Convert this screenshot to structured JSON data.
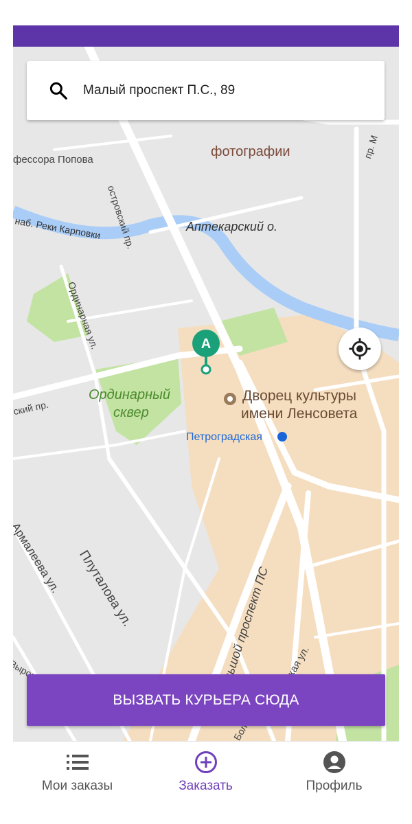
{
  "search": {
    "value": "Малый проспект П.С., 89",
    "icon": "search-icon"
  },
  "map": {
    "labels": {
      "photo": "фотографии",
      "popov": "фессора Попова",
      "ostrovsky": "островский пр.",
      "aptekarsky": "Аптекарский о.",
      "karpovka": "наб. Реки Карповки",
      "ordinarnaya": "Ординарная ул.",
      "skver1": "Ординарный",
      "skver2": "сквер",
      "palace1": "Дворец культуры",
      "palace2": "имени Ленсовета",
      "metro": "Петроградская",
      "skiy": "ский пр.",
      "plutalova": "Плуталова ул.",
      "armaleeva": "Армалеева ул.",
      "bolshoy": "Большой проспект ПС",
      "karskaya": "Карская ул.",
      "vyrova": "Вырова",
      "prm": "пр. М",
      "bol": "Бол"
    },
    "pin_label": "A",
    "colors": {
      "road": "#ffffff",
      "water": "#a9cdf7",
      "park": "#c3e3a3",
      "building": "#f5dec0",
      "pin": "#1aa17a"
    }
  },
  "actions": {
    "call_courier": "ВЫЗВАТЬ КУРЬЕРА СЮДА"
  },
  "nav": {
    "items": [
      {
        "label": "Мои заказы",
        "icon": "list-icon"
      },
      {
        "label": "Заказать",
        "icon": "add-circle-icon"
      },
      {
        "label": "Профиль",
        "icon": "account-circle-icon"
      }
    ]
  },
  "brand": {
    "accent": "#7b45c2",
    "topbar": "#5e35a8",
    "active_tab": "#6e3fba"
  }
}
